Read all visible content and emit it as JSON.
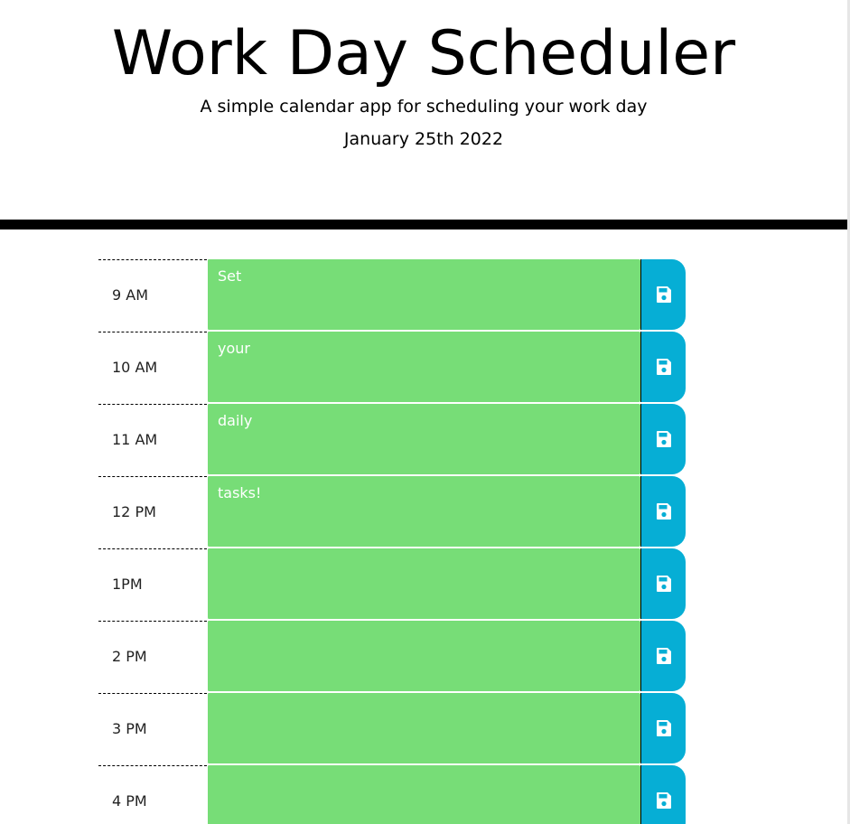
{
  "header": {
    "title": "Work Day Scheduler",
    "lead": "A simple calendar app for scheduling your work day",
    "current_day": "January 25th 2022"
  },
  "colors": {
    "present": "#77dd77",
    "save_button": "#06aed5",
    "divider": "#000000"
  },
  "save_icon": "floppy-disk-icon",
  "schedule": [
    {
      "hour": "9 AM",
      "task": "Set"
    },
    {
      "hour": "10 AM",
      "task": "your"
    },
    {
      "hour": "11 AM",
      "task": "daily"
    },
    {
      "hour": "12 PM",
      "task": "tasks!"
    },
    {
      "hour": "1PM",
      "task": ""
    },
    {
      "hour": "2 PM",
      "task": ""
    },
    {
      "hour": "3 PM",
      "task": ""
    },
    {
      "hour": "4 PM",
      "task": ""
    }
  ]
}
